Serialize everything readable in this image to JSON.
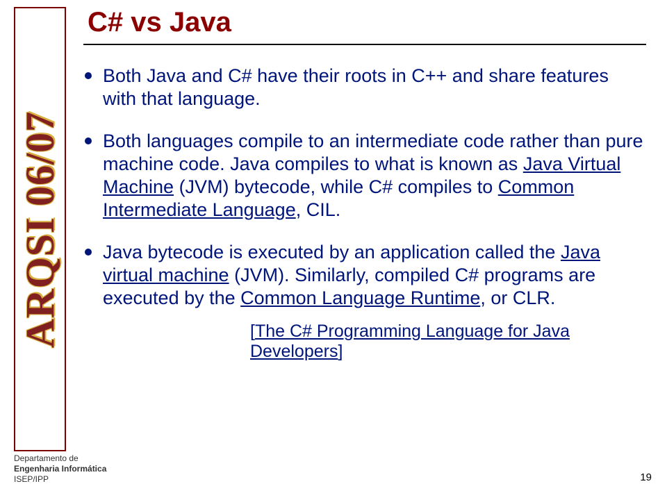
{
  "sidebar": {
    "label": "ARQSI 06/07"
  },
  "slide": {
    "title": "C# vs Java",
    "bullets": [
      {
        "pre": "Both Java and C# have their roots in C++ and share features with that language."
      },
      {
        "pre": "Both languages compile to an intermediate code rather than pure machine code. Java compiles to what is known as ",
        "u1": "Java Virtual Machine",
        "mid1": " (JVM) bytecode, while C# compiles to ",
        "u2": "Common Intermediate Language",
        "post": ", CIL."
      },
      {
        "pre": "Java bytecode is executed by an application called the ",
        "u1": "Java virtual machine",
        "mid1": " (JVM). Similarly, compiled C# programs are executed by the ",
        "u2": "Common Language Runtime",
        "post": ", or CLR."
      }
    ],
    "citation_open": "[",
    "citation_link": "The C# Programming Language for Java Developers",
    "citation_close": "]"
  },
  "footer": {
    "line1": "Departamento de",
    "line2": "Engenharia Informática",
    "line3": "ISEP/IPP"
  },
  "page_number": "19"
}
